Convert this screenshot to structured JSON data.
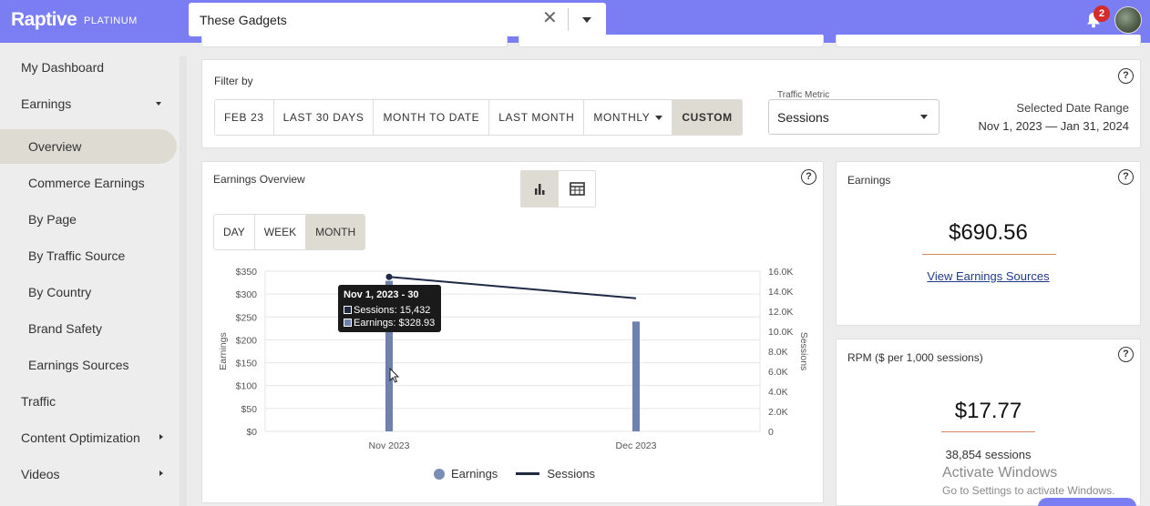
{
  "app": {
    "logo": "Raptive",
    "tier": "PLATINUM"
  },
  "site_selector": {
    "value": "These Gadgets"
  },
  "notifications": {
    "count": "2"
  },
  "sidebar": {
    "items": [
      {
        "label": "My Dashboard"
      },
      {
        "label": "Earnings"
      },
      {
        "label": "Overview"
      },
      {
        "label": "Commerce Earnings"
      },
      {
        "label": "By Page"
      },
      {
        "label": "By Traffic Source"
      },
      {
        "label": "By Country"
      },
      {
        "label": "Brand Safety"
      },
      {
        "label": "Earnings Sources"
      },
      {
        "label": "Traffic"
      },
      {
        "label": "Content Optimization"
      },
      {
        "label": "Videos"
      }
    ]
  },
  "filter": {
    "title": "Filter by",
    "buttons": [
      "FEB 23",
      "LAST 30 DAYS",
      "MONTH TO DATE",
      "LAST MONTH",
      "MONTHLY",
      "CUSTOM"
    ],
    "traffic_metric_label": "Traffic Metric",
    "traffic_metric_value": "Sessions",
    "date_range_label": "Selected Date Range",
    "date_range_value": "Nov 1, 2023 — Jan 31, 2024"
  },
  "overview": {
    "title": "Earnings Overview",
    "granularity": [
      "DAY",
      "WEEK",
      "MONTH"
    ],
    "tooltip": {
      "title": "Nov 1, 2023 - 30",
      "sessions": "Sessions: 15,432",
      "earnings": "Earnings: $328.93"
    },
    "legend": {
      "earnings": "Earnings",
      "sessions": "Sessions"
    }
  },
  "chart_data": {
    "type": "bar",
    "categories": [
      "Nov 2023",
      "Dec 2023"
    ],
    "series": [
      {
        "name": "Earnings",
        "type": "bar",
        "axis": "left",
        "values": [
          328.93,
          240
        ],
        "color": "#6f82ad"
      },
      {
        "name": "Sessions",
        "type": "line",
        "axis": "right",
        "values": [
          15432,
          13300
        ],
        "color": "#1f2a44"
      }
    ],
    "ylabel": "Earnings",
    "y2label": "Sessions",
    "yticks": [
      "$350",
      "$300",
      "$250",
      "$200",
      "$150",
      "$100",
      "$50",
      "$0"
    ],
    "y2ticks": [
      "16.0K",
      "14.0K",
      "12.0K",
      "10.0K",
      "8.0K",
      "6.0K",
      "4.0K",
      "2.0K",
      "0"
    ],
    "ylim": [
      0,
      350
    ],
    "y2lim": [
      0,
      16000
    ],
    "grid": true,
    "legend": "bottom"
  },
  "earnings_card": {
    "title": "Earnings",
    "value": "$690.56",
    "link": "View Earnings Sources"
  },
  "rpm_card": {
    "title": "RPM ($ per 1,000 sessions)",
    "value": "$17.77",
    "sessions": "38,854 sessions"
  },
  "watermark": {
    "line1": "Activate Windows",
    "line2": "Go to Settings to activate Windows."
  },
  "colors": {
    "topbar": "#7a7ef2",
    "active": "#dedbd2",
    "accent_rule": "#d88a5e"
  }
}
